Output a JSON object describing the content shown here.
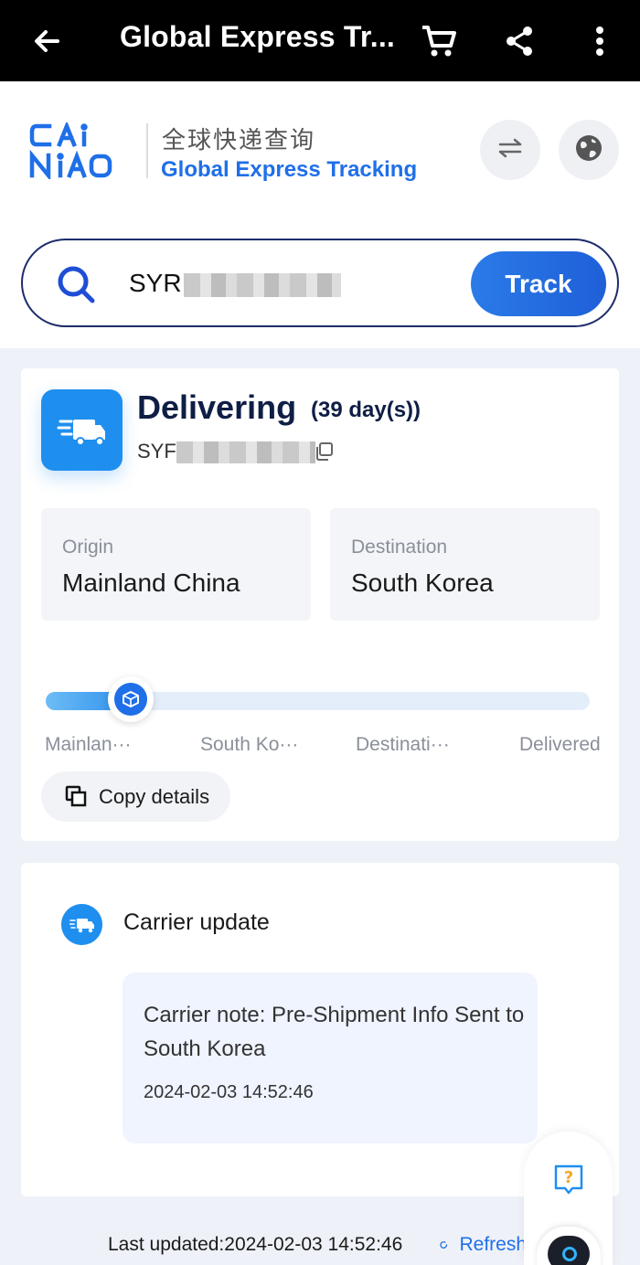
{
  "appbar": {
    "title": "Global Express Tr...",
    "icons": [
      "back-arrow-icon",
      "cart-icon",
      "share-icon",
      "more-vert-icon"
    ]
  },
  "header": {
    "logo_text": "CAINIAO",
    "cn_title": "全球快递查询",
    "en_title": "Global Express Tracking",
    "icons": [
      "swap-icon",
      "globe-icon"
    ]
  },
  "search": {
    "value_visible": "SYR",
    "button_label": "Track"
  },
  "status_card": {
    "status": "Delivering",
    "days": "(39 day(s))",
    "tracking_visible": "SYF",
    "origin": {
      "label": "Origin",
      "value": "Mainland China"
    },
    "destination": {
      "label": "Destination",
      "value": "South Korea"
    },
    "progress_fraction": 0.12,
    "stages": [
      "Mainlan···",
      "South Ko···",
      "Destinati···",
      "Delivered"
    ],
    "copy_label": "Copy details"
  },
  "carrier_card": {
    "title": "Carrier update",
    "note": "Carrier note: Pre-Shipment Info Sent to South Korea",
    "timestamp": "2024-02-03 14:52:46"
  },
  "footer": {
    "last_updated": "Last updated:2024-02-03 14:52:46",
    "refresh_label": "Refresh"
  },
  "colors": {
    "primary": "#1f6fe8",
    "status_blue": "#1f8fef",
    "dark_navy": "#0f1e45",
    "appbar": "#000000"
  }
}
